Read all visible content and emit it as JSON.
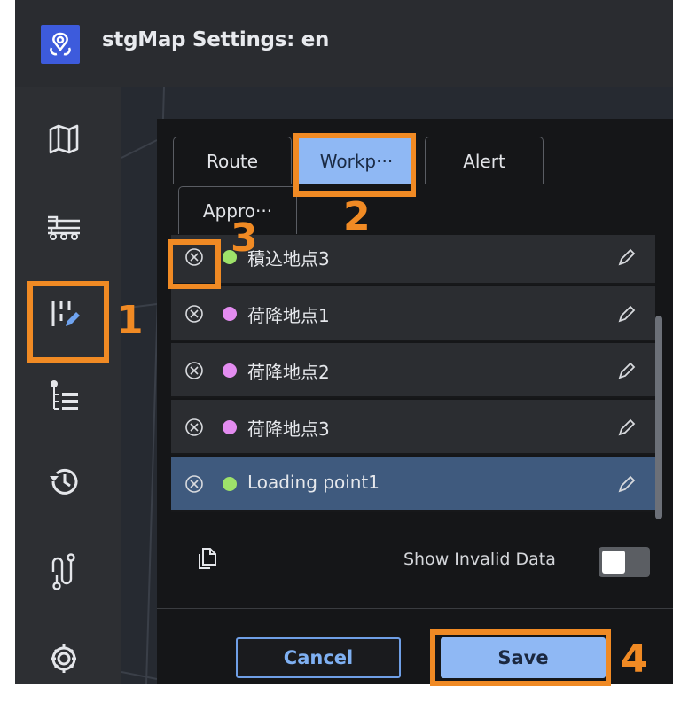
{
  "header": {
    "title": "stgMap Settings: en"
  },
  "sidebar": {
    "items": [
      {
        "name": "map-icon"
      },
      {
        "name": "truck-icon"
      },
      {
        "name": "workpoint-edit-icon"
      },
      {
        "name": "list-icon"
      },
      {
        "name": "history-icon"
      },
      {
        "name": "route-icon"
      },
      {
        "name": "gear-icon"
      }
    ]
  },
  "tabs": [
    {
      "label": "Route"
    },
    {
      "label": "Workp···"
    },
    {
      "label": "Alert"
    },
    {
      "label": "Appro···"
    }
  ],
  "workpoints": [
    {
      "label": "積込地点3",
      "color": "#9ee26a"
    },
    {
      "label": "荷降地点1",
      "color": "#e38cf0"
    },
    {
      "label": "荷降地点2",
      "color": "#e38cf0"
    },
    {
      "label": "荷降地点3",
      "color": "#e38cf0"
    },
    {
      "label": "Loading point1",
      "color": "#9ee26a"
    }
  ],
  "footer": {
    "show_invalid_label": "Show Invalid Data",
    "cancel_label": "Cancel",
    "save_label": "Save"
  },
  "annotations": [
    "1",
    "2",
    "3",
    "4"
  ],
  "colors": {
    "accent": "#8fb8f4",
    "annotation": "#f08a24",
    "selected_row": "#3f5a7e",
    "logo": "#3d5bdc"
  }
}
